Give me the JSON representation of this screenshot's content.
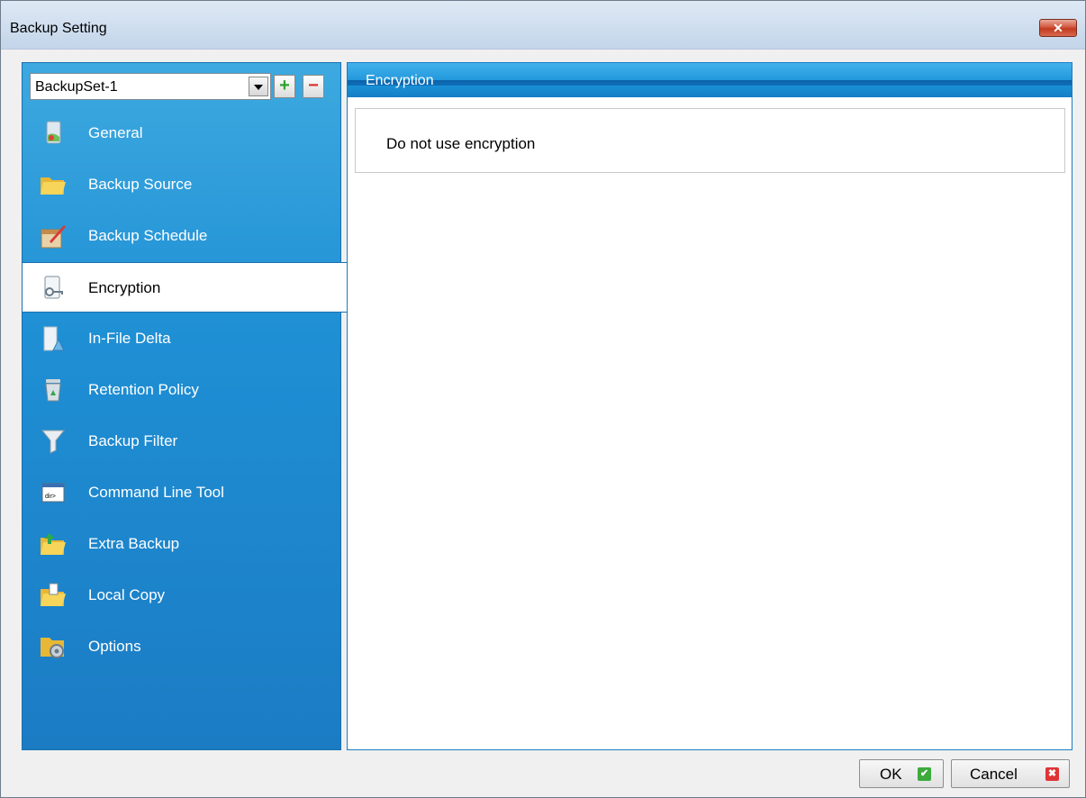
{
  "window": {
    "title": "Backup Setting",
    "close_glyph": "✕"
  },
  "sidebar": {
    "backup_set": {
      "value": "BackupSet-1"
    },
    "add_glyph": "+",
    "remove_glyph": "−",
    "items": [
      {
        "label": "General",
        "icon": "document-icon"
      },
      {
        "label": "Backup Source",
        "icon": "folder-icon"
      },
      {
        "label": "Backup Schedule",
        "icon": "calendar-icon"
      },
      {
        "label": "Encryption",
        "icon": "lock-icon",
        "selected": true
      },
      {
        "label": "In-File Delta",
        "icon": "delta-file-icon"
      },
      {
        "label": "Retention Policy",
        "icon": "recycle-bin-icon"
      },
      {
        "label": "Backup Filter",
        "icon": "filter-icon"
      },
      {
        "label": "Command Line Tool",
        "icon": "terminal-icon"
      },
      {
        "label": "Extra Backup",
        "icon": "extra-backup-folder-icon"
      },
      {
        "label": "Local Copy",
        "icon": "local-copy-folder-icon"
      },
      {
        "label": "Options",
        "icon": "options-gear-icon"
      }
    ],
    "command_icon_text": "dir>"
  },
  "main": {
    "header_title": "Encryption",
    "message": "Do not use encryption"
  },
  "footer": {
    "ok_label": "OK",
    "cancel_label": "Cancel",
    "ok_glyph": "✔",
    "cancel_glyph": "✖"
  },
  "colors": {
    "sidebar_blue": "#1f8fd4",
    "header_blue": "#1b93d8",
    "close_red": "#c23a1f",
    "ok_green": "#3cab3c",
    "cancel_red": "#e03434"
  }
}
